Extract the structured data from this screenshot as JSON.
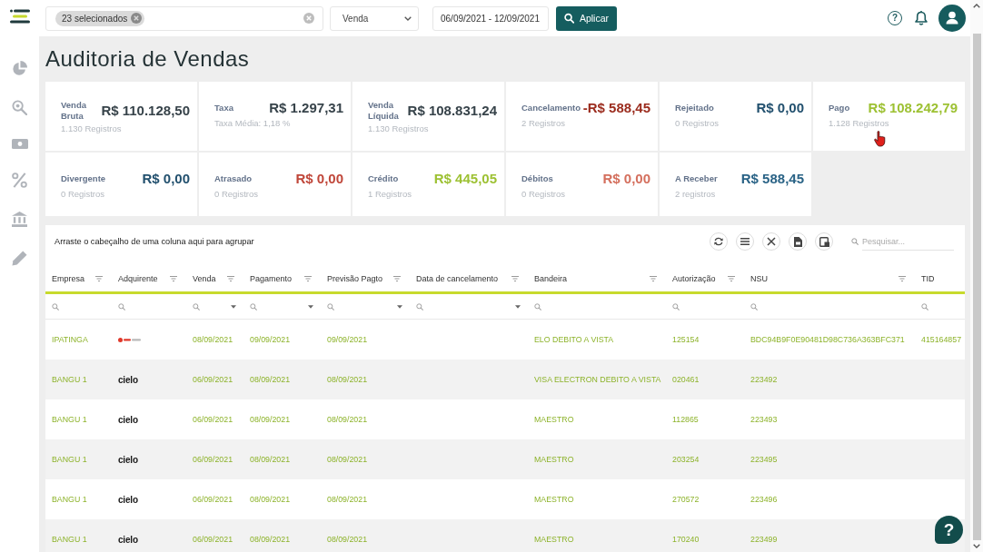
{
  "top_bar": {
    "company_filter": {
      "chip": "23 selecionados"
    },
    "operation_select": {
      "value": "Venda"
    },
    "date_range": {
      "value": "06/09/2021 - 12/09/2021"
    },
    "apply_button": {
      "label": "Aplicar"
    },
    "help": {
      "label": "?"
    }
  },
  "page": {
    "title": "Auditoria de Vendas"
  },
  "cards": [
    {
      "label": "Venda Bruta",
      "value": "R$ 110.128,50",
      "color": "#37434a",
      "note": "1.130 Registros"
    },
    {
      "label": "Taxa",
      "value": "R$ 1.297,31",
      "color": "#37434a",
      "note": "Taxa Média: 1,18 %"
    },
    {
      "label": "Venda Líquida",
      "value": "R$ 108.831,24",
      "color": "#37434a",
      "note": "1.130 Registros"
    },
    {
      "label": "Cancelamento",
      "value": "-R$ 588,45",
      "color": "#9b2c1e",
      "note": "2 Registros"
    },
    {
      "label": "Rejeitado",
      "value": "R$ 0,00",
      "color": "#22506e",
      "note": "0 Registros"
    },
    {
      "label": "Pago",
      "value": "R$ 108.242,79",
      "color": "#9dc133",
      "note": "1.128 Registros"
    },
    {
      "label": "Divergente",
      "value": "R$ 0,00",
      "color": "#22506e",
      "note": "0 Registros"
    },
    {
      "label": "Atrasado",
      "value": "R$ 0,00",
      "color": "#c0473a",
      "note": "0 Registros"
    },
    {
      "label": "Crédito",
      "value": "R$ 445,05",
      "color": "#9dc133",
      "note": "1 Registros"
    },
    {
      "label": "Débitos",
      "value": "R$ 0,00",
      "color": "#d46f5d",
      "note": "0 Registros"
    },
    {
      "label": "A Receber",
      "value": "R$ 588,45",
      "color": "#2a6386",
      "note": "2 registros"
    }
  ],
  "grid": {
    "group_hint": "Arraste o cabeçalho de uma coluna aqui para agrupar",
    "search": {
      "placeholder": "Pesquisar..."
    },
    "columns": [
      {
        "label": "Empresa",
        "kind": "text",
        "filterable": true
      },
      {
        "label": "Adquirente",
        "kind": "text",
        "filterable": true
      },
      {
        "label": "Venda",
        "kind": "date",
        "filterable": true
      },
      {
        "label": "Pagamento",
        "kind": "date",
        "filterable": true
      },
      {
        "label": "Previsão Pagto",
        "kind": "date",
        "filterable": true
      },
      {
        "label": "Data de cancelamento",
        "kind": "date",
        "filterable": true
      },
      {
        "label": "Bandeira",
        "kind": "text",
        "filterable": true
      },
      {
        "label": "Autorização",
        "kind": "text",
        "filterable": true
      },
      {
        "label": "NSU",
        "kind": "text",
        "filterable": true
      },
      {
        "label": "TID",
        "kind": "text",
        "filterable": false
      }
    ],
    "rows": [
      {
        "empresa": "IPATINGA",
        "adquirente": {
          "kind": "emblem"
        },
        "venda": "08/09/2021",
        "pagamento": "09/09/2021",
        "previsao_pagto": "09/09/2021",
        "bandeira": "ELO DEBITO A VISTA",
        "autorizacao": "125154",
        "nsu": "BDC94B9F0E90481D98C736A363BFC371",
        "tid": "415164857"
      },
      {
        "empresa": "BANGU 1",
        "adquirente": {
          "kind": "wordmark",
          "text": "cielo"
        },
        "venda": "06/09/2021",
        "pagamento": "08/09/2021",
        "previsao_pagto": "08/09/2021",
        "bandeira": "VISA ELECTRON DEBITO A VISTA",
        "autorizacao": "020461",
        "nsu": "223492"
      },
      {
        "empresa": "BANGU 1",
        "adquirente": {
          "kind": "wordmark",
          "text": "cielo"
        },
        "venda": "06/09/2021",
        "pagamento": "08/09/2021",
        "previsao_pagto": "08/09/2021",
        "bandeira": "MAESTRO",
        "autorizacao": "112865",
        "nsu": "223493"
      },
      {
        "empresa": "BANGU 1",
        "adquirente": {
          "kind": "wordmark",
          "text": "cielo"
        },
        "venda": "06/09/2021",
        "pagamento": "08/09/2021",
        "previsao_pagto": "08/09/2021",
        "bandeira": "MAESTRO",
        "autorizacao": "203254",
        "nsu": "223495"
      },
      {
        "empresa": "BANGU 1",
        "adquirente": {
          "kind": "wordmark",
          "text": "cielo"
        },
        "venda": "06/09/2021",
        "pagamento": "08/09/2021",
        "previsao_pagto": "08/09/2021",
        "bandeira": "MAESTRO",
        "autorizacao": "270572",
        "nsu": "223496"
      },
      {
        "empresa": "BANGU 1",
        "adquirente": {
          "kind": "wordmark",
          "text": "cielo"
        },
        "venda": "06/09/2021",
        "pagamento": "08/09/2021",
        "previsao_pagto": "08/09/2021",
        "bandeira": "MAESTRO",
        "autorizacao": "170240",
        "nsu": "223499"
      }
    ]
  },
  "help_button": {
    "label": "?"
  }
}
